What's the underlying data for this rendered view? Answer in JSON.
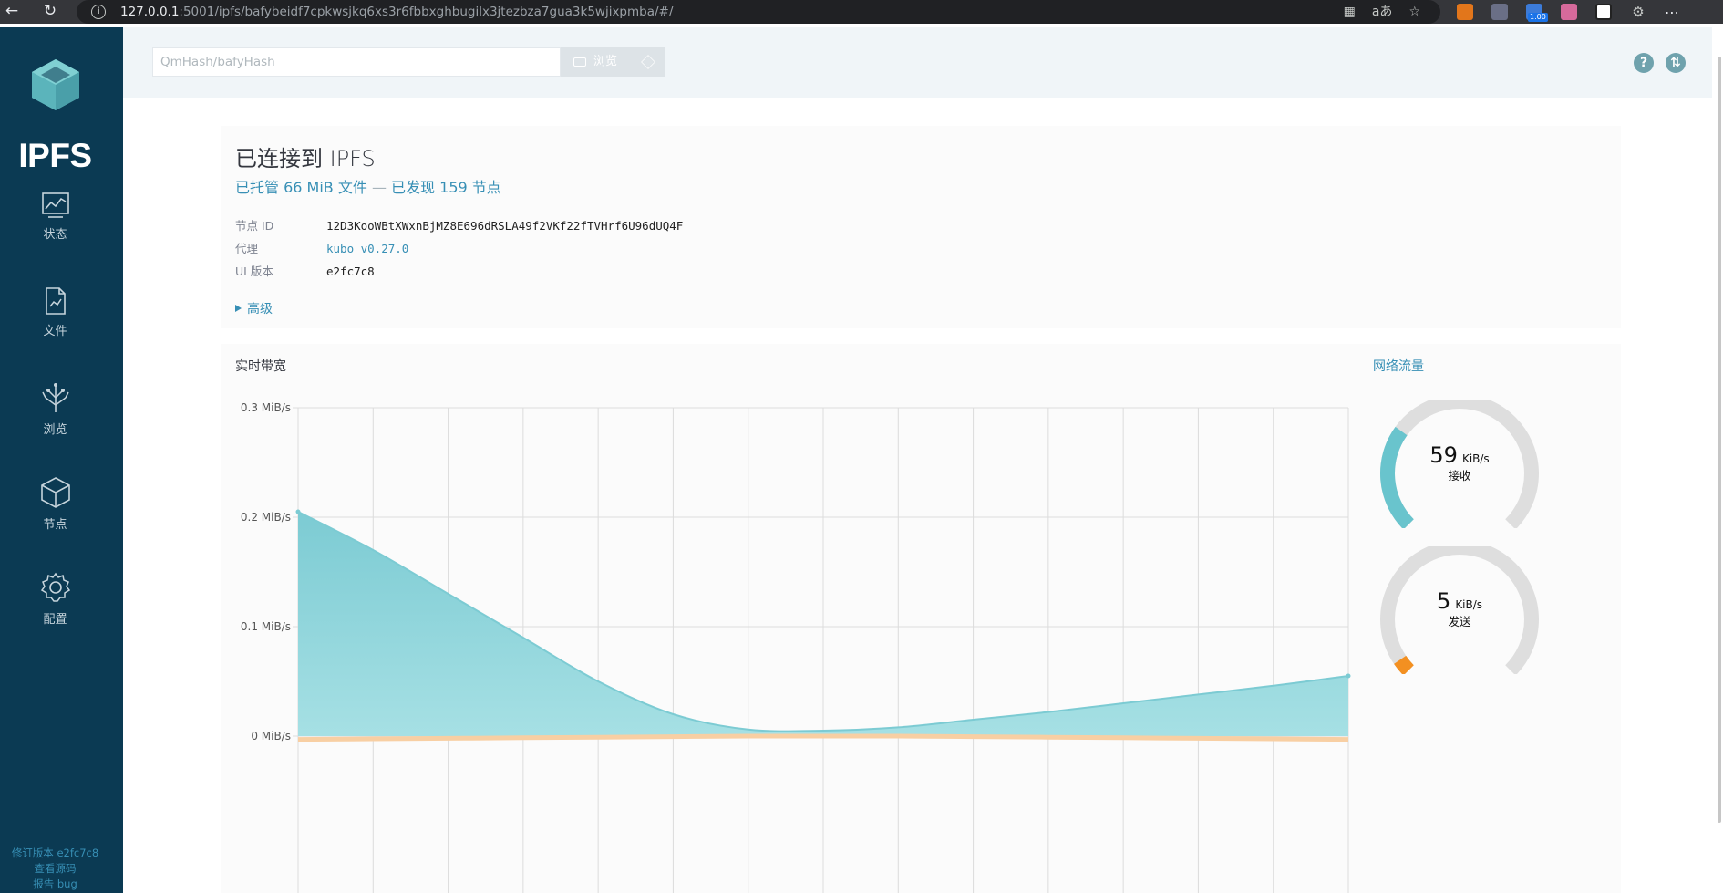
{
  "browser": {
    "url_host": "127.0.0.1",
    "url_rest": ":5001/ipfs/bafybeidf7cpkwsjkq6xs3r6fbbxghbugilx3jtezbza7gua3k5wjixpmba/#/",
    "extension_badge": "1.00",
    "icons": [
      "back-icon",
      "reload-icon",
      "info-icon",
      "reading-mode-icon",
      "translate-icon",
      "star-icon",
      "extension-icon",
      "menu-icon"
    ]
  },
  "sidebar": {
    "logo_text": "IPFS",
    "items": [
      {
        "label": "状态",
        "icon": "chart-icon"
      },
      {
        "label": "文件",
        "icon": "document-icon"
      },
      {
        "label": "浏览",
        "icon": "tree-icon"
      },
      {
        "label": "节点",
        "icon": "cube-icon"
      },
      {
        "label": "配置",
        "icon": "gear-icon"
      }
    ],
    "footer": {
      "revision": "修订版本 e2fc7c8",
      "source": "查看源码",
      "bug": "报告 bug"
    }
  },
  "topbar": {
    "search_placeholder": "QmHash/bafyHash",
    "browse_label": "浏览",
    "help_label": "?",
    "sync_label": "⇅"
  },
  "status": {
    "title": "已连接到 IPFS",
    "hosting": "已托管 66 MiB 文件",
    "dash": "—",
    "peers": "已发现 159 节点",
    "node_id_label": "节点 ID",
    "node_id": "12D3KooWBtXWxnBjMZ8E696dRSLA49f2VKf22fTVHrf6U96dUQ4F",
    "agent_label": "代理",
    "agent": "kubo v0.27.0",
    "ui_label": "UI 版本",
    "ui_version": "e2fc7c8",
    "advanced": "高级"
  },
  "bandwidth": {
    "title": "实时带宽",
    "traffic_title": "网络流量",
    "receive": {
      "value": "59",
      "unit": "KiB/s",
      "label": "接收",
      "fraction": 0.3
    },
    "send": {
      "value": "5",
      "unit": "KiB/s",
      "label": "发送",
      "fraction": 0.04
    },
    "colors": {
      "in": "#69c4cd",
      "out": "#f39021",
      "track": "#dedede",
      "teal": "#378fb5"
    }
  },
  "chart_data": {
    "type": "area",
    "title": "实时带宽",
    "ylim": [
      0,
      0.3
    ],
    "ytick_labels": [
      "0 MiB/s",
      "0.1 MiB/s",
      "0.2 MiB/s",
      "0.3 MiB/s"
    ],
    "yticks": [
      0,
      0.1,
      0.2,
      0.3
    ],
    "x": [
      0,
      1,
      2,
      3,
      4,
      5,
      6,
      7,
      8,
      9,
      10,
      11,
      12,
      13,
      14
    ],
    "series": [
      {
        "values": [
          0.205,
          0.17,
          0.13,
          0.09,
          0.05,
          0.02,
          0.006,
          0.005,
          0.008,
          0.015,
          0.022,
          0.03,
          0.038,
          0.046,
          0.055
        ]
      },
      {
        "values": [
          -0.003,
          -0.0025,
          -0.002,
          -0.0015,
          -0.001,
          -0.0005,
          0,
          0,
          0,
          -0.0005,
          -0.001,
          -0.0015,
          -0.002,
          -0.0025,
          -0.003
        ]
      }
    ]
  }
}
